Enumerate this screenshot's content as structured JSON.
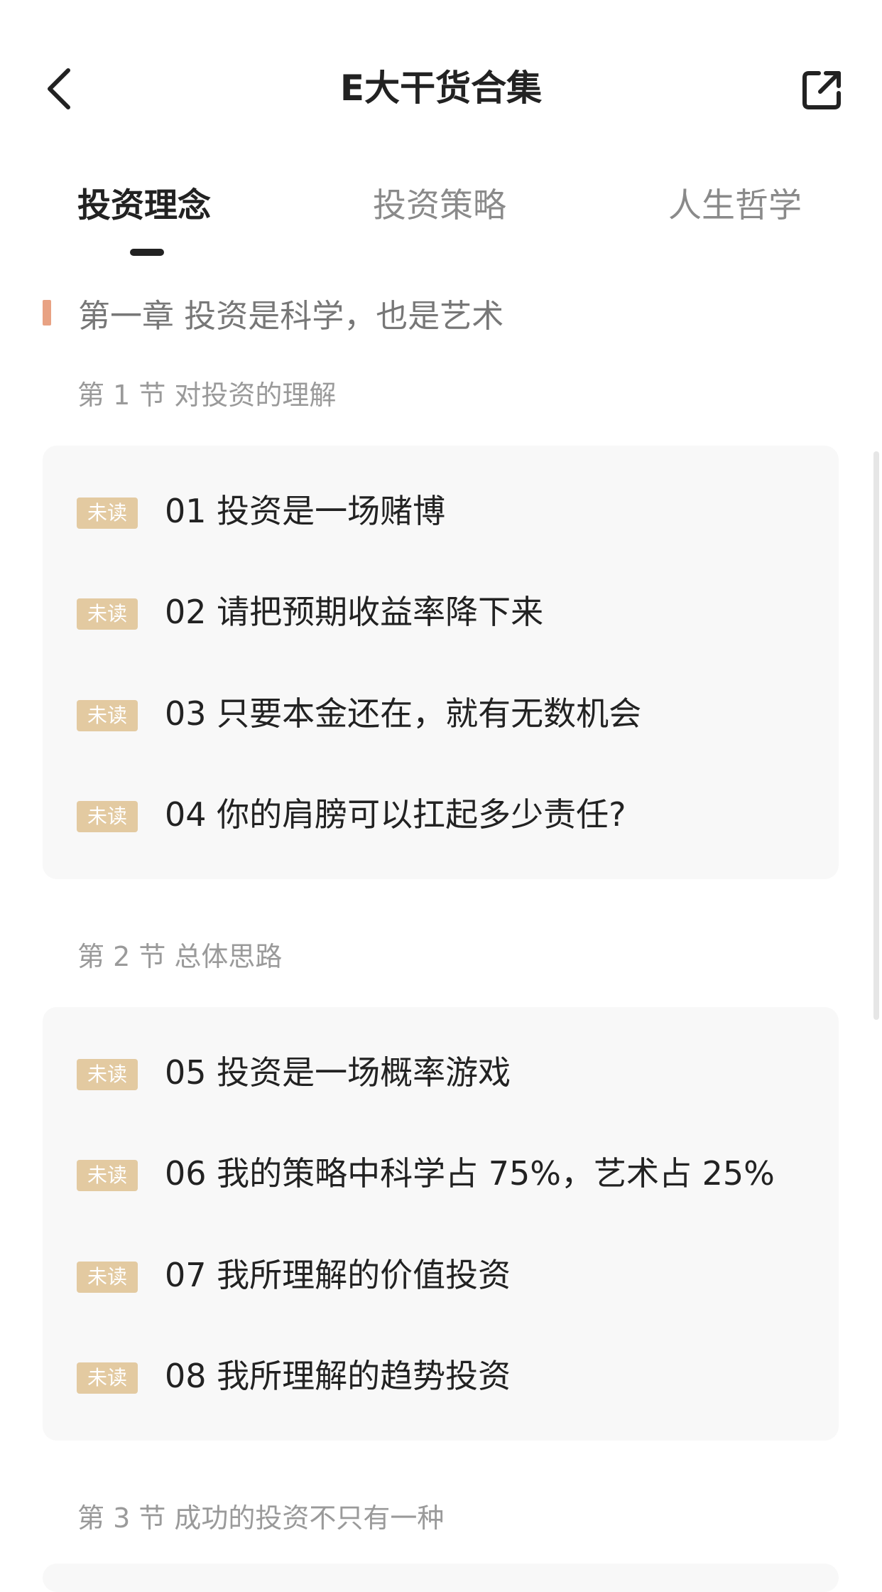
{
  "header": {
    "title": "E大干货合集",
    "back_icon": "chevron-left-icon",
    "share_icon": "share-external-icon"
  },
  "tabs": [
    {
      "label": "投资理念",
      "active": true
    },
    {
      "label": "投资策略",
      "active": false
    },
    {
      "label": "人生哲学",
      "active": false
    }
  ],
  "chapter": {
    "title": "第一章 投资是科学，也是艺术",
    "marker_color": "#e8a283"
  },
  "sections": [
    {
      "title": "第 1 节 对投资的理解",
      "items": [
        {
          "badge": "未读",
          "title": "01 投资是一场赌博"
        },
        {
          "badge": "未读",
          "title": "02 请把预期收益率降下来"
        },
        {
          "badge": "未读",
          "title": "03 只要本金还在，就有无数机会"
        },
        {
          "badge": "未读",
          "title": "04 你的肩膀可以扛起多少责任?"
        }
      ]
    },
    {
      "title": "第 2 节 总体思路",
      "items": [
        {
          "badge": "未读",
          "title": "05 投资是一场概率游戏"
        },
        {
          "badge": "未读",
          "title": "06 我的策略中科学占 75%，艺术占 25%"
        },
        {
          "badge": "未读",
          "title": "07 我所理解的价值投资"
        },
        {
          "badge": "未读",
          "title": "08 我所理解的趋势投资"
        }
      ]
    },
    {
      "title": "第 3 节 成功的投资不只有一种",
      "items": []
    }
  ],
  "colors": {
    "badge_bg": "#e3caa1",
    "card_bg": "#f8f8f8",
    "text_primary": "#222222",
    "text_secondary": "#9a9a9a"
  }
}
